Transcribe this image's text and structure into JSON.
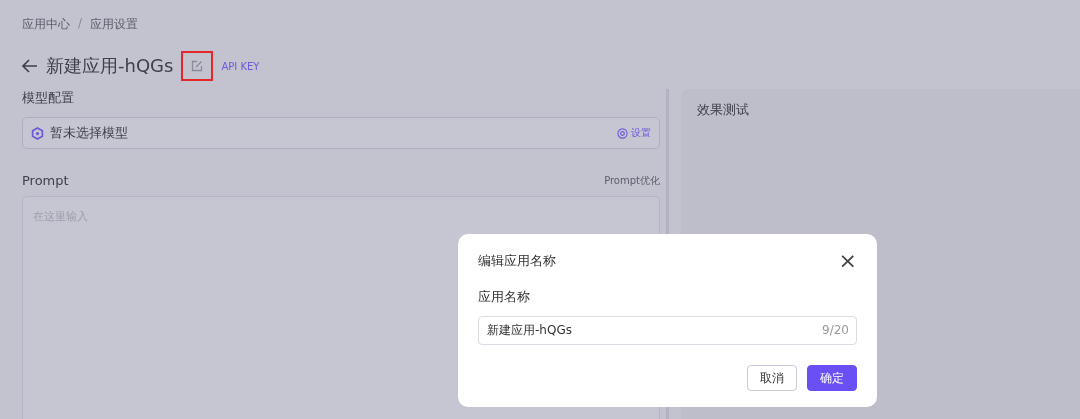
{
  "breadcrumb": [
    "应用中心",
    "应用设置"
  ],
  "breadcrumb_separator": "/",
  "header": {
    "title": "新建应用-hQGs",
    "highlighted_edit": true,
    "api_key": "API KEY"
  },
  "model_section": {
    "label": "模型配置",
    "model": "暂未选择模型",
    "settings": "设置"
  },
  "prompt_section": {
    "label": "Prompt",
    "optimize": "Prompt优化",
    "placeholder": "在这里输入"
  },
  "test_panel": {
    "title": "效果测试"
  },
  "dialog": {
    "title": "编辑应用名称",
    "close": "×",
    "field_label": "应用名称",
    "value": "新建应用-hQGs",
    "counter": "9/20",
    "buttons": [
      {
        "label": "取消",
        "kind": "secondary"
      },
      {
        "label": "确定",
        "kind": "primary"
      }
    ]
  }
}
